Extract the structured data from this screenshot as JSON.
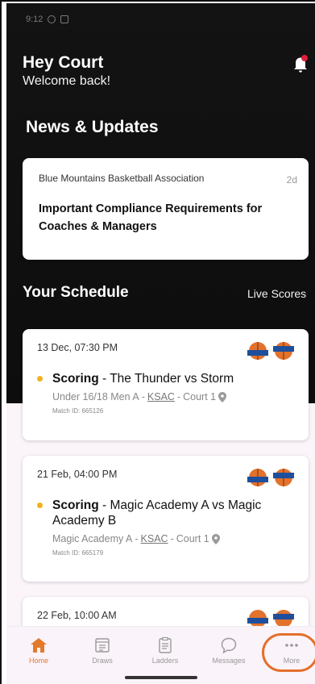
{
  "status_bar": {
    "time": "9:12"
  },
  "greeting": {
    "title": "Hey Court",
    "subtitle": "Welcome back!"
  },
  "news": {
    "section_title": "News & Updates",
    "items": [
      {
        "source": "Blue Mountains Basketball Association",
        "age": "2d",
        "headline": "Important Compliance Requirements for Coaches & Managers"
      }
    ]
  },
  "schedule": {
    "section_title": "Your Schedule",
    "live_scores_label": "Live Scores",
    "matches": [
      {
        "when": "13 Dec, 07:30 PM",
        "status": "Scoring",
        "teams": "The Thunder vs Storm",
        "division": "Under 16/18 Men A",
        "venue": "KSAC",
        "court": "Court 1",
        "match_id": "Match ID: 665126"
      },
      {
        "when": "21 Feb, 04:00 PM",
        "status": "Scoring",
        "teams": "Magic Academy A vs Magic Academy B",
        "division": "Magic Academy A",
        "venue": "KSAC",
        "court": "Court 1",
        "match_id": "Match ID: 665179"
      },
      {
        "when": "22 Feb, 10:00 AM"
      }
    ]
  },
  "tabs": [
    {
      "label": "Home",
      "icon": "home-icon",
      "active": true
    },
    {
      "label": "Draws",
      "icon": "calendar-icon",
      "active": false
    },
    {
      "label": "Ladders",
      "icon": "clipboard-icon",
      "active": false
    },
    {
      "label": "Messages",
      "icon": "chat-bubble-icon",
      "active": false
    },
    {
      "label": "More",
      "icon": "more-dots-icon",
      "active": false
    }
  ],
  "colors": {
    "accent": "#e27a2a",
    "status_dot": "#f2b21d",
    "hero": "#111111",
    "bell_badge": "#e0203a"
  }
}
